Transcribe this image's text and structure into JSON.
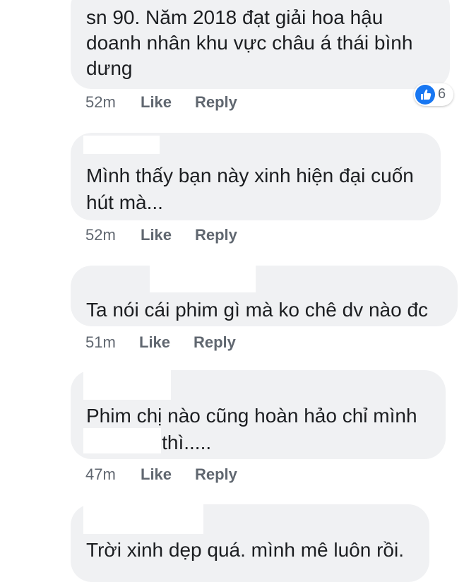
{
  "comments": [
    {
      "lines": [
        "sn 90. Năm 2018 đạt giải hoa hậu",
        "doanh nhân khu vực châu á thái bình",
        "dưng"
      ],
      "time": "52m",
      "like": "Like",
      "reply": "Reply",
      "reactions": {
        "icon": "thumbs-up-icon",
        "count": "6"
      }
    },
    {
      "lines": [
        "Mình thấy bạn này xinh hiện đại cuốn",
        "hút mà..."
      ],
      "time": "52m",
      "like": "Like",
      "reply": "Reply"
    },
    {
      "lines": [
        "Ta nói cái phim gì mà ko chê dv nào đc"
      ],
      "time": "51m",
      "like": "Like",
      "reply": "Reply"
    },
    {
      "lines": [
        "Phim chị nào cũng hoàn hảo chỉ mình",
        "› thì....."
      ],
      "time": "47m",
      "like": "Like",
      "reply": "Reply"
    },
    {
      "lines": [
        "Trời xinh dẹp quá. mình mê luôn rồi."
      ]
    }
  ],
  "colors": {
    "bubble": "#f0f1f3",
    "meta": "#606770",
    "text": "#1c1e21",
    "reaction": "#1877f2"
  }
}
